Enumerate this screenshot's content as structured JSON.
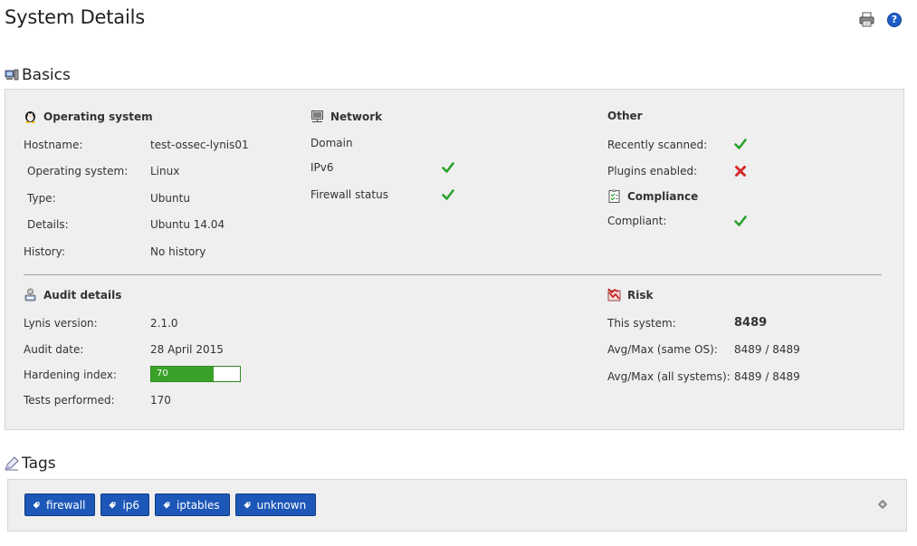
{
  "page": {
    "title": "System Details"
  },
  "toolbar": {
    "print_icon": "printer-icon",
    "help_icon": "help-icon",
    "help_glyph": "?"
  },
  "basics": {
    "heading": "Basics",
    "os": {
      "heading": "Operating system",
      "rows": [
        {
          "label": "Hostname:",
          "value": "test-ossec-lynis01"
        },
        {
          "label": "Operating system:",
          "value": "Linux"
        },
        {
          "label": "Type:",
          "value": "Ubuntu"
        },
        {
          "label": "Details:",
          "value": "Ubuntu 14.04"
        },
        {
          "label": "History:",
          "value": "No history"
        }
      ]
    },
    "network": {
      "heading": "Network",
      "rows": [
        {
          "label": "Domain",
          "status": ""
        },
        {
          "label": "IPv6",
          "status": "ok"
        },
        {
          "label": "Firewall status",
          "status": "ok"
        }
      ]
    },
    "other": {
      "heading": "Other",
      "rows": [
        {
          "label": "Recently scanned:",
          "status": "ok"
        },
        {
          "label": "Plugins enabled:",
          "status": "fail"
        }
      ]
    },
    "compliance": {
      "heading": "Compliance",
      "rows": [
        {
          "label": "Compliant:",
          "status": "ok"
        }
      ]
    },
    "audit": {
      "heading": "Audit details",
      "rows": [
        {
          "label": "Lynis version:",
          "value": "2.1.0"
        },
        {
          "label": "Audit date:",
          "value": "28 April 2015"
        },
        {
          "label": "Hardening index:",
          "value": "70"
        },
        {
          "label": "Tests performed:",
          "value": "170"
        }
      ],
      "hardening_index_fraction": 0.7
    },
    "risk": {
      "heading": "Risk",
      "rows": [
        {
          "label": "This system:",
          "value": "8489"
        },
        {
          "label": "Avg/Max (same OS):",
          "value": "8489 / 8489"
        },
        {
          "label": "Avg/Max (all systems):",
          "value": "8489 / 8489"
        }
      ]
    }
  },
  "tags": {
    "heading": "Tags",
    "items": [
      "firewall",
      "ip6",
      "iptables",
      "unknown"
    ],
    "settings_icon": "gear-icon"
  },
  "colors": {
    "accent_blue": "#1d57b8",
    "ok_green": "#2aa12a",
    "fail_red": "#d42a2a",
    "bar_green": "#3aa128"
  }
}
